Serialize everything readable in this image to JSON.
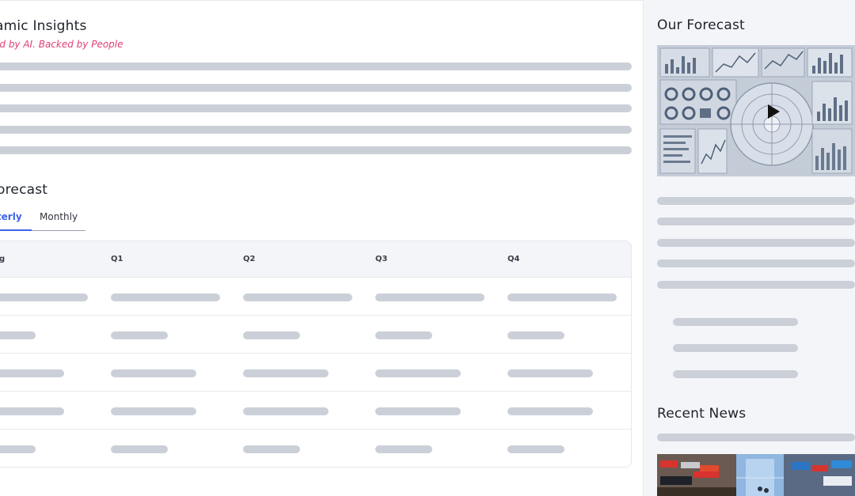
{
  "main": {
    "insights": {
      "title": "amic Insights",
      "tagline": "ed by AI. Backed by People"
    },
    "forecast": {
      "title": "orecast",
      "tabs": [
        {
          "label": "rterly",
          "active": true
        },
        {
          "label": "Monthly",
          "active": false
        }
      ],
      "table": {
        "columns": [
          "g",
          "Q1",
          "Q2",
          "Q3",
          "Q4"
        ],
        "row_count": 5
      }
    }
  },
  "sidebar": {
    "forecast_title": "Our Forecast",
    "video": {
      "icon": "play-icon"
    },
    "news_title": "Recent News"
  },
  "colors": {
    "accent": "#3d63e8",
    "tagline": "#e23d73",
    "skeleton": "#cbd0d8",
    "sidebar_bg": "#f3f5f9"
  }
}
